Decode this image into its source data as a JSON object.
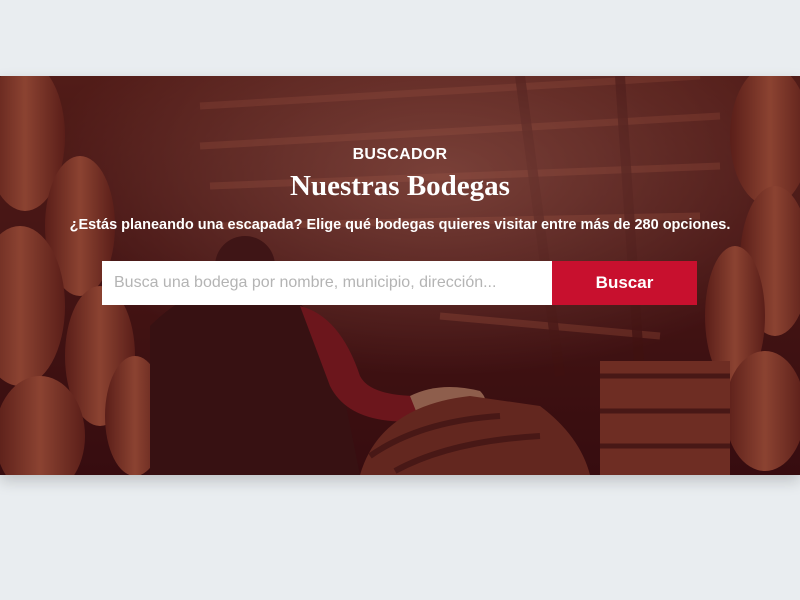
{
  "hero": {
    "eyebrow": "BUSCADOR",
    "title": "Nuestras Bodegas",
    "subtitle": "¿Estás planeando una escapada? Elige qué bodegas quieres visitar entre más de 280 opciones.",
    "background_image": "wine-cellar-barrels-photo"
  },
  "search": {
    "placeholder": "Busca una bodega por nombre, municipio, dirección...",
    "value": "",
    "button_label": "Buscar"
  },
  "colors": {
    "page_background": "#e9edf0",
    "overlay": "#480c14",
    "button": "#c8102e",
    "text": "#ffffff"
  }
}
